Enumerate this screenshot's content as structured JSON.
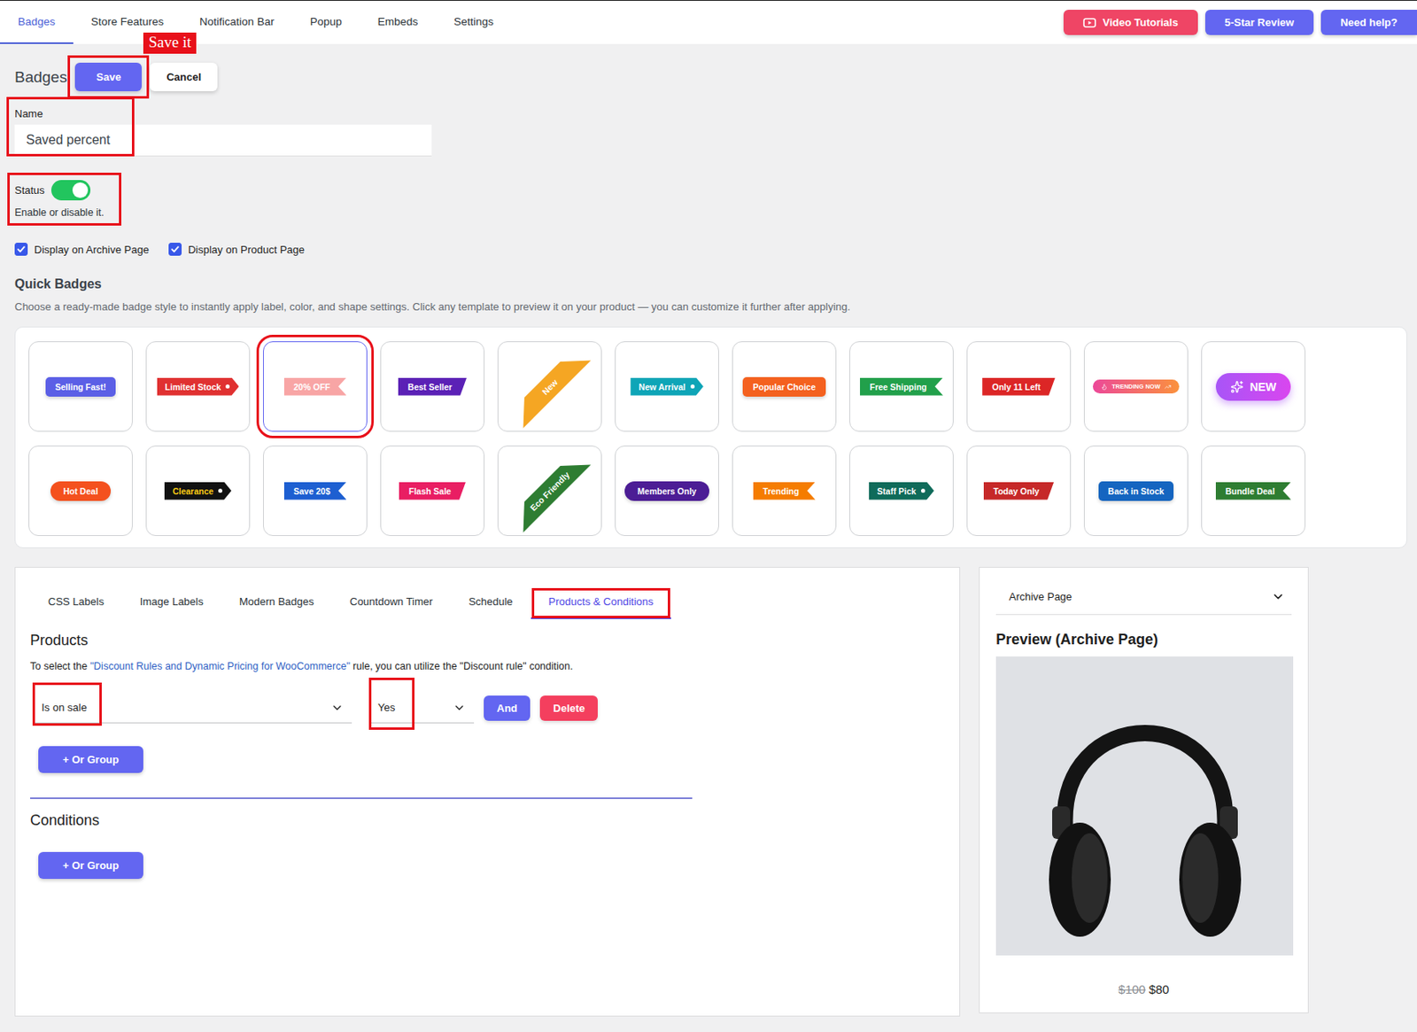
{
  "nav": {
    "tabs": [
      {
        "label": "Badges",
        "selected": true
      },
      {
        "label": "Store Features",
        "selected": false
      },
      {
        "label": "Notification Bar",
        "selected": false
      },
      {
        "label": "Popup",
        "selected": false
      },
      {
        "label": "Embeds",
        "selected": false
      },
      {
        "label": "Settings",
        "selected": false
      }
    ],
    "buttons": [
      {
        "label": "Video Tutorials",
        "color": "#ef4565",
        "kind": "video"
      },
      {
        "label": "5-Star Review",
        "color": "#6366f1",
        "kind": "plain"
      },
      {
        "label": "Need help?",
        "color": "#6366f1",
        "kind": "plain"
      }
    ]
  },
  "header": {
    "title": "Badges",
    "buttons": [
      {
        "label": "Save",
        "kind": "primary",
        "annotated": true
      },
      {
        "label": "Cancel",
        "kind": "secondary",
        "annotated": false
      }
    ]
  },
  "annotation": {
    "label": "Save it"
  },
  "name_field": {
    "label": "Name",
    "value": "Saved percent",
    "annotated": true
  },
  "status": {
    "label": "Status",
    "hint": "Enable or disable it.",
    "on": true,
    "annotated": true
  },
  "display_options": [
    {
      "label": "Display on Archive Page",
      "checked": true
    },
    {
      "label": "Display on Product Page",
      "checked": true
    }
  ],
  "quick_badges": {
    "title": "Quick Badges",
    "description": "Choose a ready-made badge style to instantly apply label, color, and shape settings. Click any template to preview it on your product — you can customize it further after applying.",
    "items": [
      {
        "label": "Selling Fast!",
        "kind": "rounded",
        "color": "#5b5fe6",
        "text_color": "#ffffff",
        "selected": false,
        "annotated": false
      },
      {
        "label": "Limited Stock",
        "kind": "tag",
        "color": "#e03131",
        "text_color": "#ffffff",
        "selected": false,
        "annotated": false
      },
      {
        "label": "20% OFF",
        "kind": "ribbon",
        "color": "#f8a5a5",
        "text_color": "#ffffff",
        "selected": true,
        "annotated": true
      },
      {
        "label": "Best Seller",
        "kind": "slant",
        "color": "#5b21b6",
        "text_color": "#ffffff",
        "selected": false,
        "annotated": false
      },
      {
        "label": "New",
        "kind": "corner",
        "color": "#f5a623",
        "text_color": "#ffffff",
        "selected": false,
        "annotated": false
      },
      {
        "label": "New Arrival",
        "kind": "tag",
        "color": "#0ea5b7",
        "text_color": "#ffffff",
        "selected": false,
        "annotated": false
      },
      {
        "label": "Popular Choice",
        "kind": "rounded",
        "color": "#f4611f",
        "text_color": "#ffffff",
        "selected": false,
        "annotated": false
      },
      {
        "label": "Free Shipping",
        "kind": "ribbon",
        "color": "#22a04b",
        "text_color": "#ffffff",
        "selected": false,
        "annotated": false
      },
      {
        "label": "Only 11 Left",
        "kind": "slant",
        "color": "#dc2626",
        "text_color": "#ffffff",
        "selected": false,
        "annotated": false
      },
      {
        "label": "TRENDING NOW",
        "kind": "trend",
        "color": "#ec4899",
        "text_color": "#ffffff",
        "selected": false,
        "annotated": false
      },
      {
        "label": "NEW",
        "kind": "sparkle",
        "color": "#a855f7",
        "text_color": "#ffffff",
        "selected": false,
        "annotated": false
      },
      {
        "label": "Hot Deal",
        "kind": "pill",
        "color": "#f4511e",
        "text_color": "#ffffff",
        "selected": false,
        "annotated": false
      },
      {
        "label": "Clearance",
        "kind": "tag",
        "color": "#111111",
        "text_color": "#facc15",
        "selected": false,
        "annotated": false
      },
      {
        "label": "Save 20$",
        "kind": "ribbon",
        "color": "#1d5fd1",
        "text_color": "#ffffff",
        "selected": false,
        "annotated": false
      },
      {
        "label": "Flash Sale",
        "kind": "slant",
        "color": "#e91e63",
        "text_color": "#ffffff",
        "selected": false,
        "annotated": false
      },
      {
        "label": "Eco Friendly",
        "kind": "corner",
        "color": "#2e7d32",
        "text_color": "#ffffff",
        "selected": false,
        "annotated": false
      },
      {
        "label": "Members Only",
        "kind": "pill",
        "color": "#4c1d95",
        "text_color": "#ffffff",
        "selected": false,
        "annotated": false
      },
      {
        "label": "Trending",
        "kind": "ribbon",
        "color": "#f57c00",
        "text_color": "#ffffff",
        "selected": false,
        "annotated": false
      },
      {
        "label": "Staff Pick",
        "kind": "tag",
        "color": "#0f6b5a",
        "text_color": "#ffffff",
        "selected": false,
        "annotated": false
      },
      {
        "label": "Today Only",
        "kind": "slant",
        "color": "#c62828",
        "text_color": "#ffffff",
        "selected": false,
        "annotated": false
      },
      {
        "label": "Back in Stock",
        "kind": "rounded",
        "color": "#1565c0",
        "text_color": "#ffffff",
        "selected": false,
        "annotated": false
      },
      {
        "label": "Bundle Deal",
        "kind": "ribbon",
        "color": "#2e7d32",
        "text_color": "#ffffff",
        "selected": false,
        "annotated": false
      }
    ]
  },
  "editor": {
    "tabs": [
      {
        "label": "CSS Labels",
        "selected": false,
        "annotated": false
      },
      {
        "label": "Image Labels",
        "selected": false,
        "annotated": false
      },
      {
        "label": "Modern Badges",
        "selected": false,
        "annotated": false
      },
      {
        "label": "Countdown Timer",
        "selected": false,
        "annotated": false
      },
      {
        "label": "Schedule",
        "selected": false,
        "annotated": false
      },
      {
        "label": "Products & Conditions",
        "selected": true,
        "annotated": true
      }
    ],
    "products": {
      "title": "Products",
      "note": {
        "prefix": "To select the ",
        "link": "\"Discount Rules and Dynamic Pricing for WooCommerce\"",
        "suffix": " rule, you can utilize the \"Discount rule\" condition."
      },
      "rules": [
        {
          "field": "Is on sale",
          "value": "Yes",
          "field_annotated": true,
          "value_annotated": true,
          "buttons": [
            {
              "label": "And",
              "color": "#6366f1"
            },
            {
              "label": "Delete",
              "color": "#f43f5e"
            }
          ]
        }
      ],
      "or_group": "+ Or Group"
    },
    "conditions": {
      "title": "Conditions",
      "or_group": "+ Or Group"
    }
  },
  "preview": {
    "select": "Archive Page",
    "title": "Preview (Archive Page)",
    "price_old": "$100",
    "price_new": "$80"
  }
}
